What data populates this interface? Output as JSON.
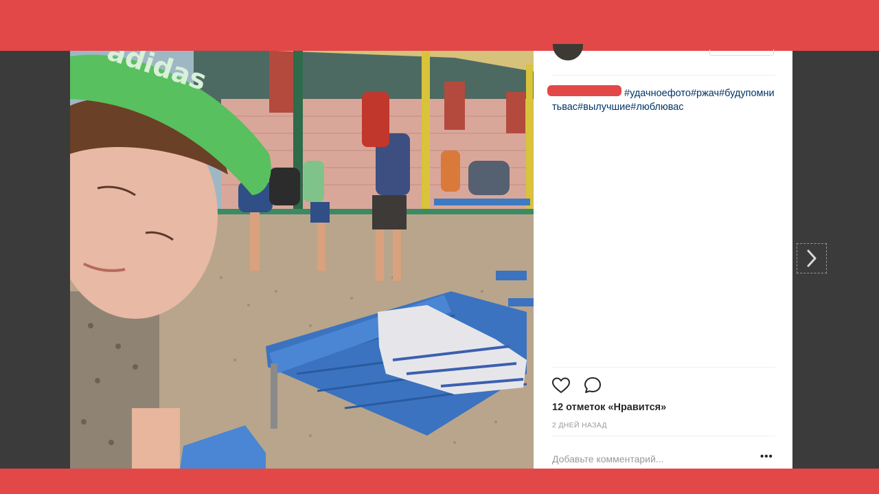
{
  "post": {
    "user_name": "",
    "caption": "#удачноефото#ржач#будупомнитьвас#вылучшие#люблювас",
    "likes_text": "12 отметок «Нравится»",
    "timestamp": "2 ДНЕЙ НАЗАД",
    "comment_placeholder": "Добавьте комментарий...",
    "more_label": "•••"
  },
  "photo": {
    "cap_text": "adidas"
  },
  "icons": {
    "like": "heart-icon",
    "comment": "comment-bubble-icon",
    "next": "chevron-right-icon",
    "more": "ellipsis-icon"
  },
  "colors": {
    "redaction": "#e24848",
    "hashtag": "#003569",
    "muted": "#999999"
  }
}
